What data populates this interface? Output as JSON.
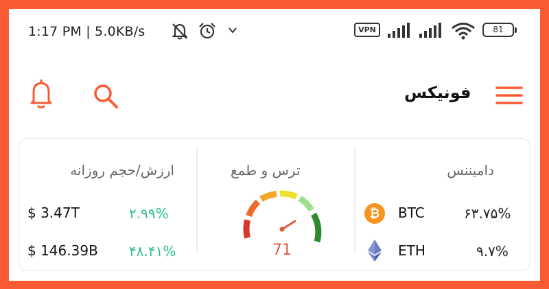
{
  "status_bar": {
    "time_speed": "1:17 PM | 5.0KB/s",
    "vpn_label": "VPN",
    "battery_level": "81",
    "icons": [
      "notifications-off-icon",
      "alarm-icon",
      "chevron-down-icon",
      "signal-icon",
      "signal-icon",
      "wifi-icon",
      "battery-icon"
    ]
  },
  "header": {
    "title": "فونیکس",
    "icons": [
      "menu-icon",
      "search-icon",
      "bell-icon"
    ],
    "accent_color": "#fb5b33"
  },
  "market_card": {
    "value_volume": {
      "title": "ارزش/حجم روزانه",
      "rows": [
        {
          "value": "$ 3.47T",
          "change": "۲.۹۹%"
        },
        {
          "value": "$ 146.39B",
          "change": "۴۸.۴۱%"
        }
      ],
      "change_color": "#2cc08b"
    },
    "fear_greed": {
      "title": "ترس و طمع",
      "value": "71",
      "value_color": "#e05a3a"
    },
    "dominance": {
      "title": "دامیننس",
      "rows": [
        {
          "symbol": "BTC",
          "percent": "۶۳.۷۵%",
          "icon": "bitcoin-icon",
          "color": "#f7931a"
        },
        {
          "symbol": "ETH",
          "percent": "۹.۷%",
          "icon": "ethereum-icon",
          "color": "#6b7bbf"
        }
      ]
    }
  }
}
